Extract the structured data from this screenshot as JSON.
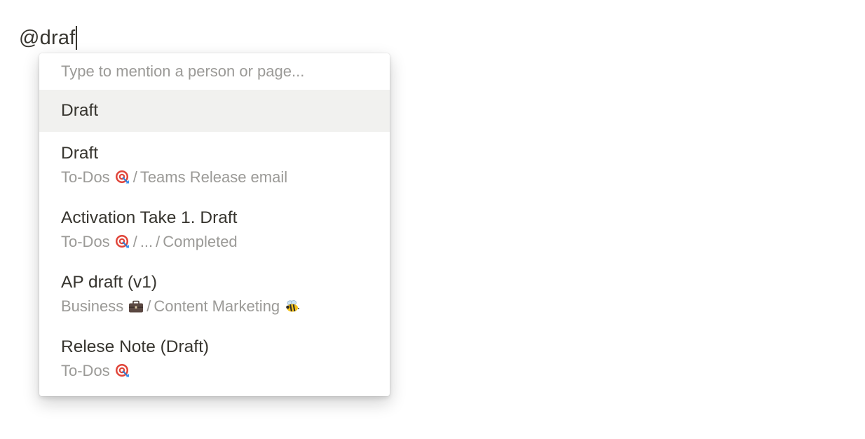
{
  "editor": {
    "typed_text": "@draf"
  },
  "mention_menu": {
    "placeholder": "Type to mention a person or page...",
    "items": [
      {
        "title": "Draft",
        "active": true
      },
      {
        "title": "Draft",
        "path": [
          {
            "label": "To-Dos",
            "icon": "target-icon"
          },
          {
            "label": "Teams Release email"
          }
        ]
      },
      {
        "title": "Activation Take 1. Draft",
        "path": [
          {
            "label": "To-Dos",
            "icon": "target-icon"
          },
          {
            "label": "..."
          },
          {
            "label": "Completed"
          }
        ]
      },
      {
        "title": "AP draft (v1)",
        "path": [
          {
            "label": "Business",
            "icon": "briefcase-icon"
          },
          {
            "label": "Content Marketing",
            "icon": "bee-icon"
          }
        ]
      },
      {
        "title": "Relese Note (Draft)",
        "path": [
          {
            "label": "To-Dos",
            "icon": "target-icon"
          }
        ]
      }
    ],
    "path_separator": "/"
  },
  "colors": {
    "text_primary": "#37352f",
    "text_secondary": "#9b9a97",
    "highlight_bg": "#f1f1ef"
  }
}
